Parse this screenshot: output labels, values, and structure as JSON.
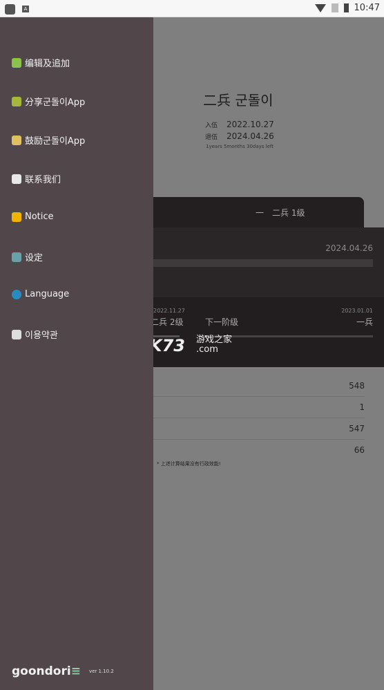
{
  "status_bar": {
    "time": "10:47"
  },
  "main": {
    "title": "二兵 군돌이",
    "enlist_label": "入伍",
    "enlist_date": "2022.10.27",
    "discharge_label": "退伍",
    "discharge_date": "2024.04.26",
    "remaining": "1years 5months 30days left",
    "rank_tab": "一　二兵 1级",
    "panel_date": "2024.04.26",
    "prev_date": "2022.11.27",
    "prev_rank": "二兵 2级",
    "next_label": "下一阶级",
    "next_date": "2023.01.01",
    "next_rank": "一兵",
    "next_progress_percent": 1,
    "stats": [
      "548",
      "1",
      "547",
      "66"
    ],
    "note": "* 上述计算结果没有行政效能!"
  },
  "watermark": {
    "brand": "K73",
    "text": "游戏之家",
    "domain": ".com"
  },
  "drawer": {
    "items": [
      {
        "label": "编辑及追加",
        "icon": "pencil-icon",
        "color": "#8bc34a"
      },
      {
        "label": "分享군돌이App",
        "icon": "share-coin-icon",
        "color": "#a5b83a"
      },
      {
        "label": "鼓励군돌이App",
        "icon": "cheers-icon",
        "color": "#e0c060"
      },
      {
        "label": "联系我们",
        "icon": "envelope-icon",
        "color": "#e8e8e8"
      },
      {
        "label": "Notice",
        "icon": "megaphone-icon",
        "color": "#f0b400"
      },
      {
        "label": "设定",
        "icon": "tools-icon",
        "color": "#6aa0a8"
      },
      {
        "label": "Language",
        "icon": "globe-icon",
        "color": "#2a8ac0"
      },
      {
        "label": "이용약관",
        "icon": "document-icon",
        "color": "#dddddd"
      }
    ],
    "logo": "goondori",
    "version": "ver 1.10.2"
  }
}
